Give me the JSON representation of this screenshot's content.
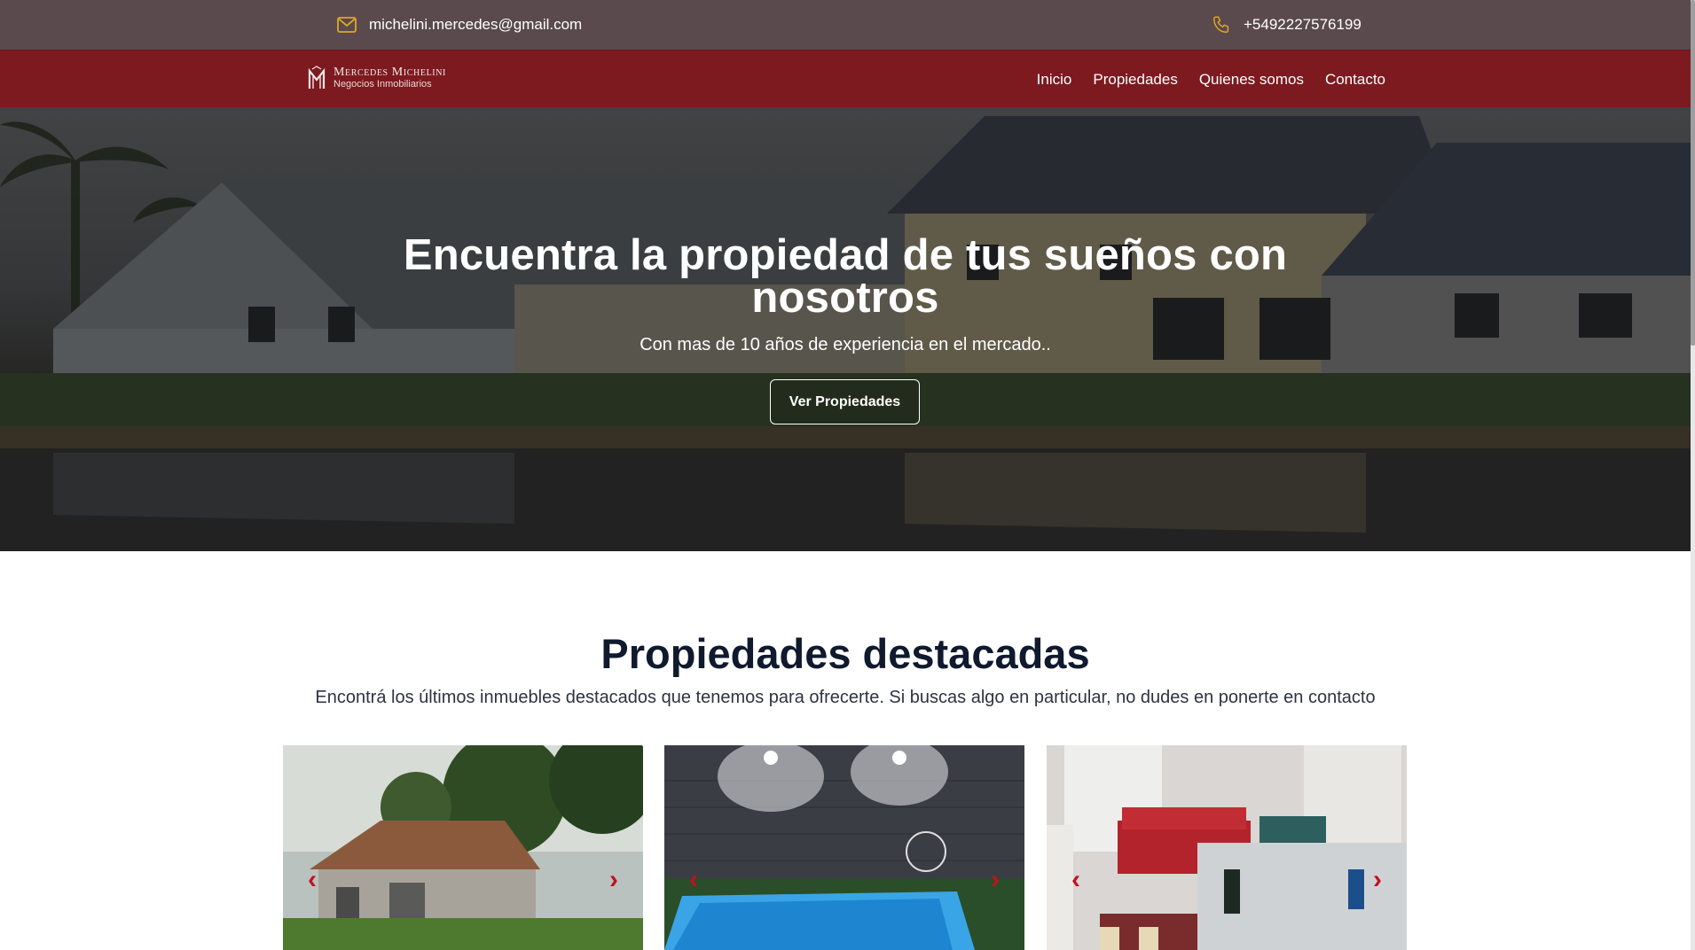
{
  "topbar": {
    "email": "michelini.mercedes@gmail.com",
    "phone": "+5492227576199",
    "email_icon": "envelope-icon",
    "phone_icon": "phone-icon",
    "icon_color": "#e0a526"
  },
  "brand": {
    "name": "Mercedes Michelini",
    "tagline": "Negocios Inmobiliarios"
  },
  "nav": {
    "items": [
      "Inicio",
      "Propiedades",
      "Quienes somos",
      "Contacto"
    ]
  },
  "hero": {
    "title": "Encuentra la propiedad de tus sueños con nosotros",
    "subtitle": "Con mas de 10 años de experiencia en el mercado..",
    "cta": "Ver Propiedades"
  },
  "featured": {
    "title": "Propiedades destacadas",
    "subtitle": "Encontrá los últimos inmuebles destacados que tenemos para ofrecerte. Si buscas algo en particular, no dudes en ponerte en contacto",
    "cards": [
      {
        "image": "house-photo",
        "prev": "‹",
        "next": "›"
      },
      {
        "image": "pool-photo",
        "prev": "‹",
        "next": "›"
      },
      {
        "image": "living-room-photo",
        "prev": "‹",
        "next": "›"
      }
    ]
  },
  "colors": {
    "topbar": "#5a4a4d",
    "navbar": "#7d1a1f",
    "carousel_arrow": "#c1121f",
    "heading": "#101a2e"
  }
}
